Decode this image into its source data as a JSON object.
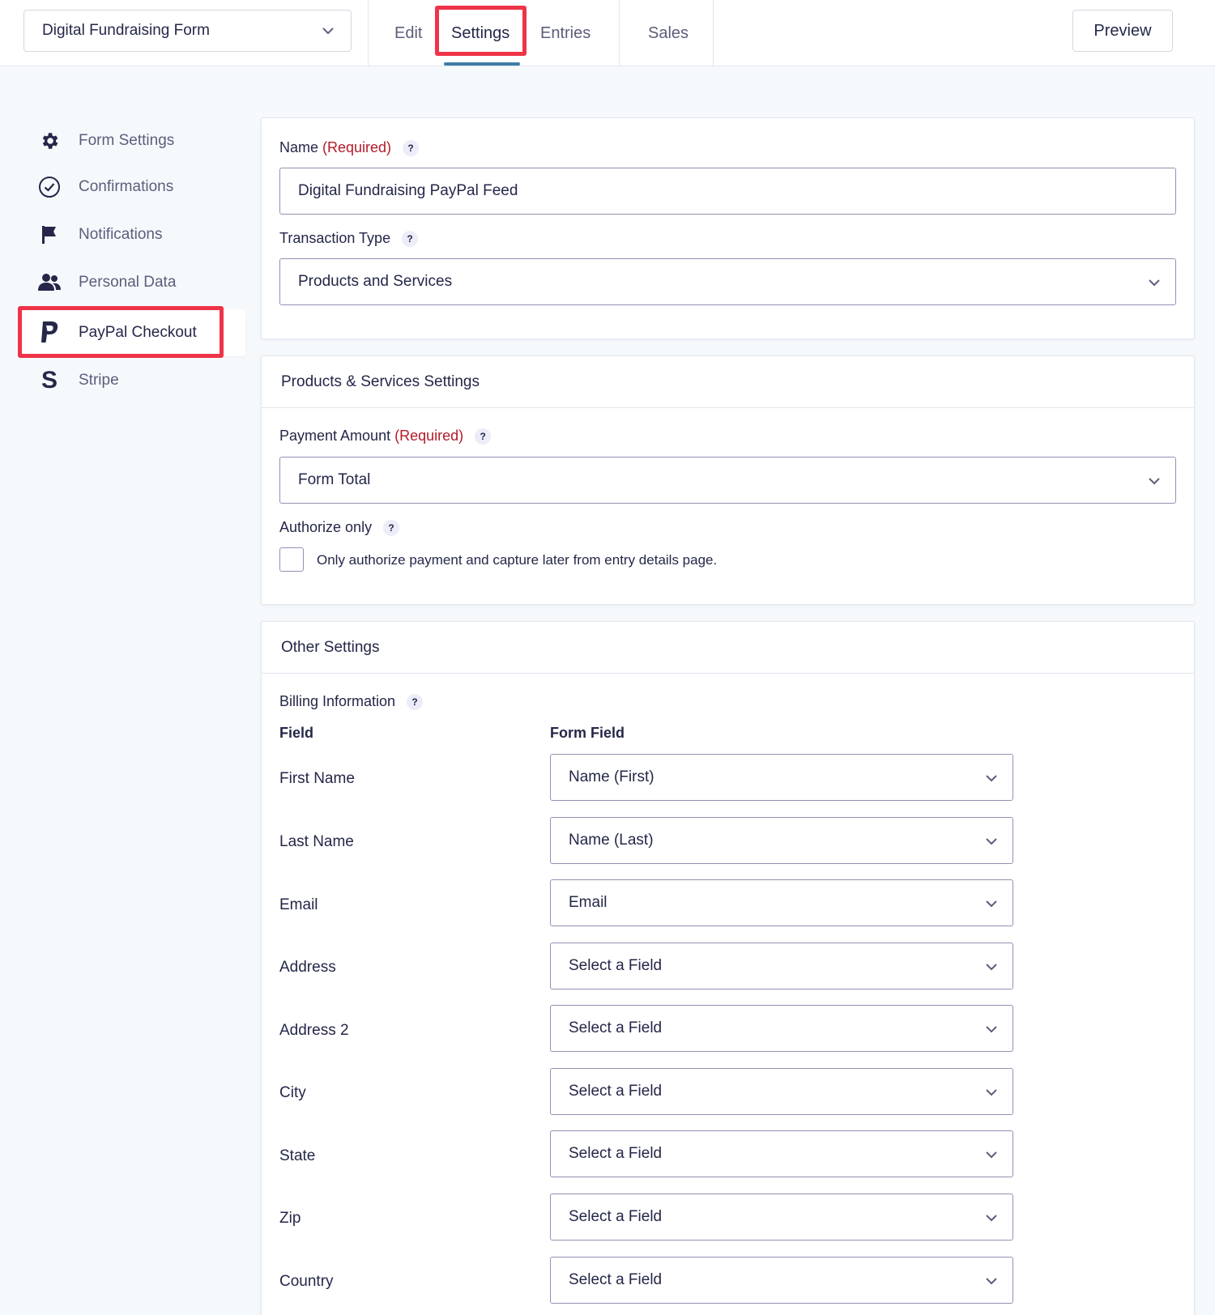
{
  "header": {
    "form_name": "Digital Fundraising Form",
    "tabs": [
      {
        "label": "Edit"
      },
      {
        "label": "Settings"
      },
      {
        "label": "Entries"
      },
      {
        "label": "Sales"
      }
    ],
    "preview_label": "Preview"
  },
  "sidebar": {
    "items": [
      {
        "label": "Form Settings",
        "icon": "gear-icon"
      },
      {
        "label": "Confirmations",
        "icon": "check-circle-icon"
      },
      {
        "label": "Notifications",
        "icon": "flag-icon"
      },
      {
        "label": "Personal Data",
        "icon": "users-icon"
      },
      {
        "label": "PayPal Checkout",
        "icon": "paypal-icon"
      },
      {
        "label": "Stripe",
        "icon": "stripe-icon"
      }
    ]
  },
  "feed": {
    "name_label": "Name",
    "required_text": "(Required)",
    "name_value": "Digital Fundraising PayPal Feed",
    "transaction_type_label": "Transaction Type",
    "transaction_type_value": "Products and Services"
  },
  "products_services": {
    "title": "Products & Services Settings",
    "payment_amount_label": "Payment Amount",
    "required_text": "(Required)",
    "payment_amount_value": "Form Total",
    "authorize_label": "Authorize only",
    "authorize_checkbox_label": "Only authorize payment and capture later from entry details page."
  },
  "other_settings": {
    "title": "Other Settings",
    "billing_label": "Billing Information",
    "col_field": "Field",
    "col_form_field": "Form Field",
    "rows": [
      {
        "field": "First Name",
        "value": "Name (First)"
      },
      {
        "field": "Last Name",
        "value": "Name (Last)"
      },
      {
        "field": "Email",
        "value": "Email"
      },
      {
        "field": "Address",
        "value": "Select a Field"
      },
      {
        "field": "Address 2",
        "value": "Select a Field"
      },
      {
        "field": "City",
        "value": "Select a Field"
      },
      {
        "field": "State",
        "value": "Select a Field"
      },
      {
        "field": "Zip",
        "value": "Select a Field"
      },
      {
        "field": "Country",
        "value": "Select a Field"
      }
    ]
  },
  "colors": {
    "highlight": "#ef3348",
    "required": "#b31b28",
    "tab_underline": "#3e7da6",
    "text": "#242748"
  }
}
